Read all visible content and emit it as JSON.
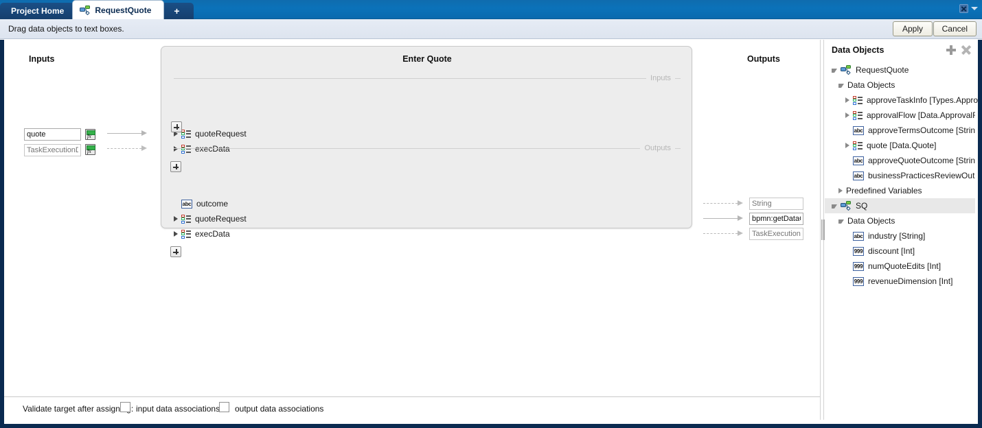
{
  "window": {
    "close_icon": "close-icon",
    "menu_caret_icon": "chevron-down-icon"
  },
  "tabs": [
    {
      "label": "Project Home",
      "active": false,
      "icon": ""
    },
    {
      "label": "RequestQuote",
      "active": true,
      "icon": "bpmn-process-icon"
    },
    {
      "label": "+",
      "active": false,
      "icon": ""
    }
  ],
  "toolbar": {
    "hint": "Drag data objects to text boxes.",
    "apply_label": "Apply",
    "cancel_label": "Cancel"
  },
  "inputs_column": {
    "title": "Inputs",
    "fields": [
      {
        "value": "quote",
        "placeholder": "",
        "expression_icon": "fx-icon",
        "connector": "solid"
      },
      {
        "value": "",
        "placeholder": "TaskExecutionData",
        "expression_icon": "fx-icon",
        "connector": "dashed"
      }
    ]
  },
  "center_panel": {
    "title": "Enter Quote",
    "inputs_separator": "Inputs",
    "outputs_separator": "Outputs",
    "inputs": [
      {
        "label": "quoteRequest",
        "icon": "structure-icon",
        "expandable": true
      },
      {
        "label": "execData",
        "icon": "structure-icon",
        "expandable": true
      }
    ],
    "outputs": [
      {
        "label": "outcome",
        "icon": "abc-icon",
        "expandable": false
      },
      {
        "label": "quoteRequest",
        "icon": "structure-icon",
        "expandable": true
      },
      {
        "label": "execData",
        "icon": "structure-icon",
        "expandable": true
      }
    ],
    "add_input_label": "+",
    "add_output_label": "+"
  },
  "outputs_column": {
    "title": "Outputs",
    "fields": [
      {
        "value": "",
        "placeholder": "String",
        "connector": "dashed"
      },
      {
        "value": "bpmn:getDataObj",
        "placeholder": "",
        "connector": "solid"
      },
      {
        "value": "",
        "placeholder": "TaskExecutionData",
        "connector": "dashed"
      }
    ]
  },
  "data_objects_panel": {
    "title": "Data Objects",
    "add_icon": "plus-icon",
    "close_icon": "close-icon",
    "tree": [
      {
        "label": "RequestQuote",
        "icon": "bpmn-process-icon",
        "indent": 0,
        "twisty": "down",
        "selected": false
      },
      {
        "label": "Data Objects",
        "icon": "",
        "indent": 1,
        "twisty": "down",
        "selected": false
      },
      {
        "label": "approveTaskInfo [Types.Approve",
        "icon": "structure-icon",
        "indent": 2,
        "twisty": "right",
        "selected": false
      },
      {
        "label": "approvalFlow [Data.ApprovalFlo",
        "icon": "structure-icon",
        "indent": 2,
        "twisty": "right",
        "selected": false
      },
      {
        "label": "approveTermsOutcome [String]",
        "icon": "abc-icon",
        "indent": 2,
        "twisty": "none",
        "selected": false
      },
      {
        "label": "quote [Data.Quote]",
        "icon": "structure-icon",
        "indent": 2,
        "twisty": "right",
        "selected": false
      },
      {
        "label": "approveQuoteOutcome [String]",
        "icon": "abc-icon",
        "indent": 2,
        "twisty": "none",
        "selected": false
      },
      {
        "label": "businessPracticesReviewOutcom",
        "icon": "abc-icon",
        "indent": 2,
        "twisty": "none",
        "selected": false
      },
      {
        "label": "Predefined Variables",
        "icon": "",
        "indent": 1,
        "twisty": "right",
        "selected": false
      },
      {
        "label": "SQ",
        "icon": "subprocess-icon",
        "indent": 0,
        "twisty": "down",
        "selected": true
      },
      {
        "label": "Data Objects",
        "icon": "",
        "indent": 1,
        "twisty": "down",
        "selected": false
      },
      {
        "label": "industry [String]",
        "icon": "abc-icon",
        "indent": 2,
        "twisty": "none",
        "selected": false
      },
      {
        "label": "discount [Int]",
        "icon": "999-icon",
        "indent": 2,
        "twisty": "none",
        "selected": false
      },
      {
        "label": "numQuoteEdits [Int]",
        "icon": "999-icon",
        "indent": 2,
        "twisty": "none",
        "selected": false
      },
      {
        "label": "revenueDimension [Int]",
        "icon": "999-icon",
        "indent": 2,
        "twisty": "none",
        "selected": false
      }
    ]
  },
  "validation_bar": {
    "label": "Validate target after assigning:",
    "checkboxes": [
      {
        "label": "input data associations",
        "checked": false
      },
      {
        "label": "output data associations",
        "checked": false
      }
    ]
  },
  "colors": {
    "tab_bar_blue": "#0b72b9",
    "tab_inactive": "#163f6d",
    "toolbar": "#dde4ef",
    "panel_gray": "#ededed",
    "window_border": "#0a2a50",
    "selection": "#e8e8e8"
  }
}
